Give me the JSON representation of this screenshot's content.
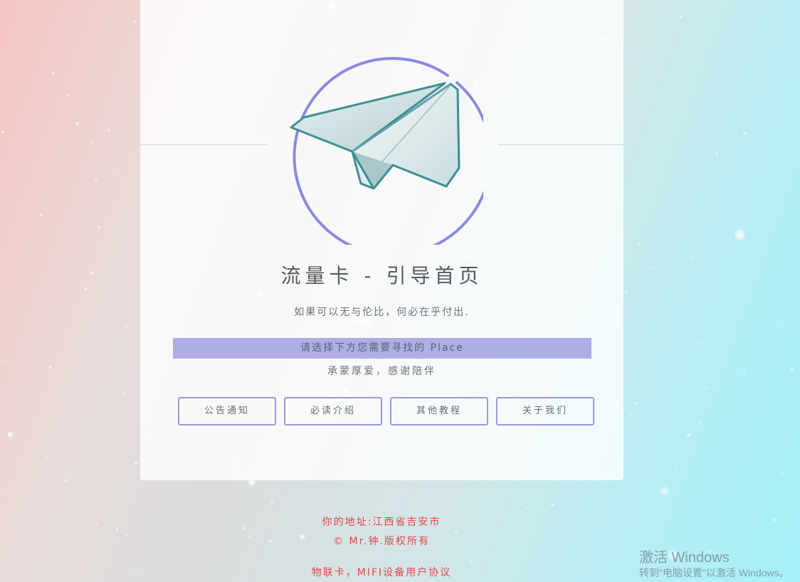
{
  "card": {
    "title": "流量卡 - 引导首页",
    "subtitle": "如果可以无与伦比，何必在乎付出.",
    "prompt": "请选择下方您需要寻找的 Place",
    "thanks": "承蒙厚爱，感谢陪伴"
  },
  "nav": {
    "buttons": [
      "公告通知",
      "必读介绍",
      "其他教程",
      "关于我们"
    ]
  },
  "footer": {
    "address": "你的地址:江西省吉安市",
    "copyright": "© Mr.钟.版权所有",
    "agreement": "物联卡，MIFI设备用户协议"
  },
  "watermark": {
    "title": "激活 Windows",
    "hint": "转到\"电脑设置\"以激活 Windows。"
  },
  "icons": {
    "logo": "paper-plane-icon"
  },
  "colors": {
    "accent": "#8a8ae0",
    "prompt_bg": "#aeaee4",
    "footer_text": "#e34848"
  }
}
